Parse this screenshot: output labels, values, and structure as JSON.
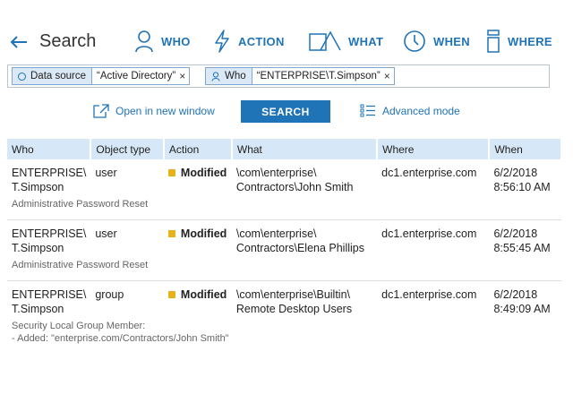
{
  "header": {
    "title": "Search",
    "nav": [
      {
        "label": "WHO"
      },
      {
        "label": "ACTION"
      },
      {
        "label": "WHAT"
      },
      {
        "label": "WHEN"
      },
      {
        "label": "WHERE"
      }
    ]
  },
  "filters": [
    {
      "key": "Data source",
      "value": "“Active Directory”",
      "remove": "×"
    },
    {
      "key": "Who",
      "value": "“ENTERPRISE\\T.Simpson”",
      "remove": "×"
    }
  ],
  "actions": {
    "open_window": "Open in new window",
    "search": "SEARCH",
    "advanced": "Advanced mode"
  },
  "table": {
    "columns": [
      "Who",
      "Object type",
      "Action",
      "What",
      "Where",
      "When"
    ],
    "rows": [
      {
        "who": "ENTERPRISE\\\nT.Simpson",
        "type": "user",
        "action": "Modified",
        "what": "\\com\\enterprise\\\nContractors\\John Smith",
        "where": "dc1.enterprise.com",
        "when": "6/2/2018\n8:56:10 AM",
        "desc": "Administrative Password Reset"
      },
      {
        "who": "ENTERPRISE\\\nT.Simpson",
        "type": "user",
        "action": "Modified",
        "what": "\\com\\enterprise\\\nContractors\\Elena Phillips",
        "where": "dc1.enterprise.com",
        "when": "6/2/2018\n8:55:45 AM",
        "desc": "Administrative Password Reset"
      },
      {
        "who": "ENTERPRISE\\\nT.Simpson",
        "type": "group",
        "action": "Modified",
        "what": "\\com\\enterprise\\Builtin\\\nRemote Desktop Users",
        "where": "dc1.enterprise.com",
        "when": "6/2/2018\n8:49:09 AM",
        "desc": "Security Local Group Member:\n- Added: \"enterprise.com/Contractors/John Smith\""
      }
    ]
  },
  "colors": {
    "accent": "#1f73b7",
    "header_bg": "#d6e8f7",
    "modified": "#e8b21a"
  }
}
